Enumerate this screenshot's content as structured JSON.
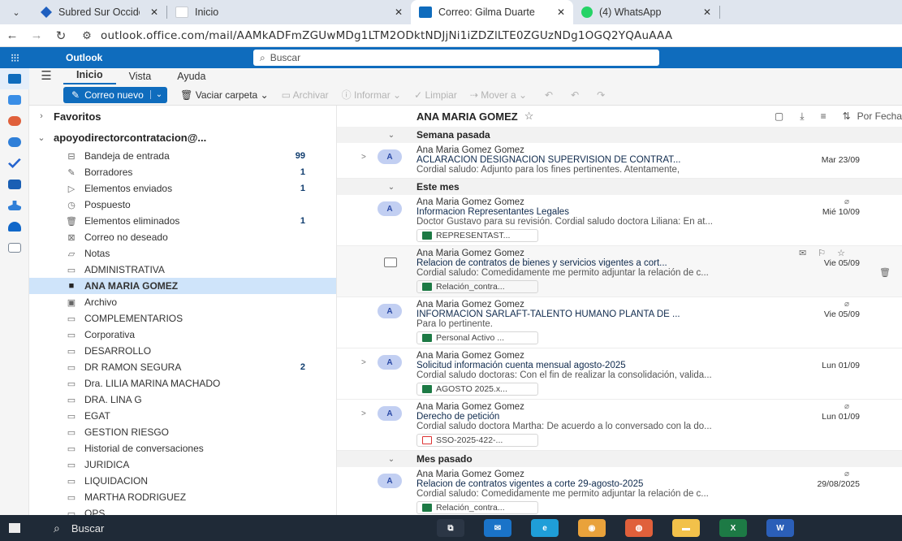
{
  "browser": {
    "tabs": [
      {
        "title": "Subred Sur Occidente",
        "favicon": "subred-favicon"
      },
      {
        "title": "Inicio",
        "favicon": "blank-favicon"
      },
      {
        "title": "Correo: Gilma Duarte",
        "favicon": "outlook-favicon",
        "active": true
      },
      {
        "title": "(4) WhatsApp",
        "favicon": "whatsapp-favicon"
      }
    ],
    "url": "outlook.office.com/mail/AAMkADFmZGUwMDg1LTM2ODktNDJjNi1iZDZlLTE0ZGUzNDg1OGQ2YQAuAAA"
  },
  "outlook": {
    "app_name": "Outlook",
    "search_placeholder": "Buscar",
    "ribbon_tabs": [
      "Inicio",
      "Vista",
      "Ayuda"
    ],
    "toolbar": {
      "new_mail": "Correo nuevo",
      "empty_folder": "Vaciar carpeta",
      "archive": "Archivar",
      "report": "Informar",
      "sweep": "Limpiar",
      "move_to": "Mover a"
    }
  },
  "folders": {
    "favorites_label": "Favoritos",
    "account_label": "apoyodirectorcontratacion@...",
    "items": [
      {
        "label": "Bandeja de entrada",
        "count": "99",
        "icon": "inbox-icon"
      },
      {
        "label": "Borradores",
        "count": "1",
        "icon": "drafts-icon"
      },
      {
        "label": "Elementos enviados",
        "count": "1",
        "icon": "sent-icon"
      },
      {
        "label": "Pospuesto",
        "count": "",
        "icon": "clock-icon"
      },
      {
        "label": "Elementos eliminados",
        "count": "1",
        "icon": "trash-icon"
      },
      {
        "label": "Correo no deseado",
        "count": "",
        "icon": "junk-icon"
      },
      {
        "label": "Notas",
        "count": "",
        "icon": "notes-icon"
      },
      {
        "label": "ADMINISTRATIVA",
        "count": "",
        "icon": "folder-icon"
      },
      {
        "label": "ANA MARIA GOMEZ",
        "count": "",
        "icon": "folder-icon",
        "selected": true
      },
      {
        "label": "Archivo",
        "count": "",
        "icon": "archive-icon"
      },
      {
        "label": "COMPLEMENTARIOS",
        "count": "",
        "icon": "folder-icon"
      },
      {
        "label": "Corporativa",
        "count": "",
        "icon": "folder-icon"
      },
      {
        "label": "DESARROLLO",
        "count": "",
        "icon": "folder-icon"
      },
      {
        "label": "DR RAMON SEGURA",
        "count": "2",
        "icon": "folder-icon"
      },
      {
        "label": "Dra. LILIA MARINA MACHADO",
        "count": "",
        "icon": "folder-icon"
      },
      {
        "label": "DRA. LINA G",
        "count": "",
        "icon": "folder-icon"
      },
      {
        "label": "EGAT",
        "count": "",
        "icon": "folder-icon"
      },
      {
        "label": "GESTION RIESGO",
        "count": "",
        "icon": "folder-icon"
      },
      {
        "label": "Historial de conversaciones",
        "count": "",
        "icon": "folder-icon"
      },
      {
        "label": "JURIDICA",
        "count": "",
        "icon": "folder-icon"
      },
      {
        "label": "LIQUIDACION",
        "count": "",
        "icon": "folder-icon"
      },
      {
        "label": "MARTHA RODRIGUEZ",
        "count": "",
        "icon": "folder-icon"
      },
      {
        "label": "OPS",
        "count": "",
        "icon": "folder-icon"
      }
    ]
  },
  "list": {
    "folder_title": "ANA MARIA GOMEZ",
    "sort_label": "Por Fecha",
    "groups": [
      {
        "label": "Semana pasada",
        "messages": [
          {
            "avatar": "A",
            "from": "Ana Maria Gomez Gomez",
            "subject": "ACLARACIÓN DESIGNACIÓN SUPERVISIÓN DE CONTRAT...",
            "date": "Mar 23/09",
            "preview": "Cordial saludo: Adjunto para los fines pertinentes. Atentamente,",
            "attachment": "",
            "expand": true
          }
        ]
      },
      {
        "label": "Este mes",
        "messages": [
          {
            "avatar": "A",
            "from": "Ana Maria Gomez Gomez",
            "subject": "Informacion Representantes Legales",
            "date": "Mié 10/09",
            "preview": "Doctor Gustavo para su revisión. Cordial saludo doctora Liliana: En at...",
            "attachment": "REPRESENTAST...",
            "att_type": "xls",
            "clip": true
          },
          {
            "avatar": "",
            "from": "Ana Maria Gomez Gomez",
            "subject": "Relacion de contratos de bienes y servicios vigentes a cort...",
            "date": "Vie 05/09",
            "preview": "Cordial saludo: Comedidamente me permito adjuntar la relación de c...",
            "attachment": "Relación_contra...",
            "att_type": "xls",
            "hover": true
          },
          {
            "avatar": "A",
            "from": "Ana Maria Gomez Gomez",
            "subject": "INFORMACIÓN SARLAFT-TALENTO HUMANO PLANTA DE ...",
            "date": "Vie 05/09",
            "preview": "Para lo pertinente.",
            "attachment": "Personal Activo ...",
            "att_type": "xls",
            "clip": true
          },
          {
            "avatar": "A",
            "from": "Ana Maria Gomez Gomez",
            "subject": "Solicitud información cuenta mensual agosto-2025",
            "date": "Lun 01/09",
            "preview": "Cordial saludo doctoras: Con el fin de realizar la consolidación, valida...",
            "attachment": "AGOSTO 2025.x...",
            "att_type": "xls",
            "expand": true
          },
          {
            "avatar": "A",
            "from": "Ana Maria Gomez Gomez",
            "subject": "Derecho de petición",
            "date": "Lun 01/09",
            "preview": "Cordial saludo doctora Martha: De acuerdo a lo conversado con la do...",
            "attachment": "SSO-2025-422-...",
            "att_type": "pdf",
            "expand": true,
            "clip": true
          }
        ]
      },
      {
        "label": "Mes pasado",
        "messages": [
          {
            "avatar": "A",
            "from": "Ana Maria Gomez Gomez",
            "subject": "Relacion de contratos vigentes a corte 29-agosto-2025",
            "date": "29/08/2025",
            "preview": "Cordial saludo: Comedidamente me permito adjuntar la relación de c...",
            "attachment": "Relación_contra...",
            "att_type": "xls",
            "clip": true
          }
        ]
      }
    ]
  },
  "taskbar": {
    "search_label": "Buscar",
    "apps": [
      {
        "name": "task-view-icon",
        "color": "#2b3645"
      },
      {
        "name": "mail-app-icon",
        "color": "#1a73c8"
      },
      {
        "name": "edge-icon",
        "color": "#1f9ed8"
      },
      {
        "name": "chrome-icon",
        "color": "#e9a23b"
      },
      {
        "name": "firefox-icon",
        "color": "#e0603b"
      },
      {
        "name": "file-explorer-icon",
        "color": "#f2c14a"
      },
      {
        "name": "excel-icon",
        "color": "#1d7a45"
      },
      {
        "name": "word-icon",
        "color": "#2b5fb8"
      }
    ]
  }
}
